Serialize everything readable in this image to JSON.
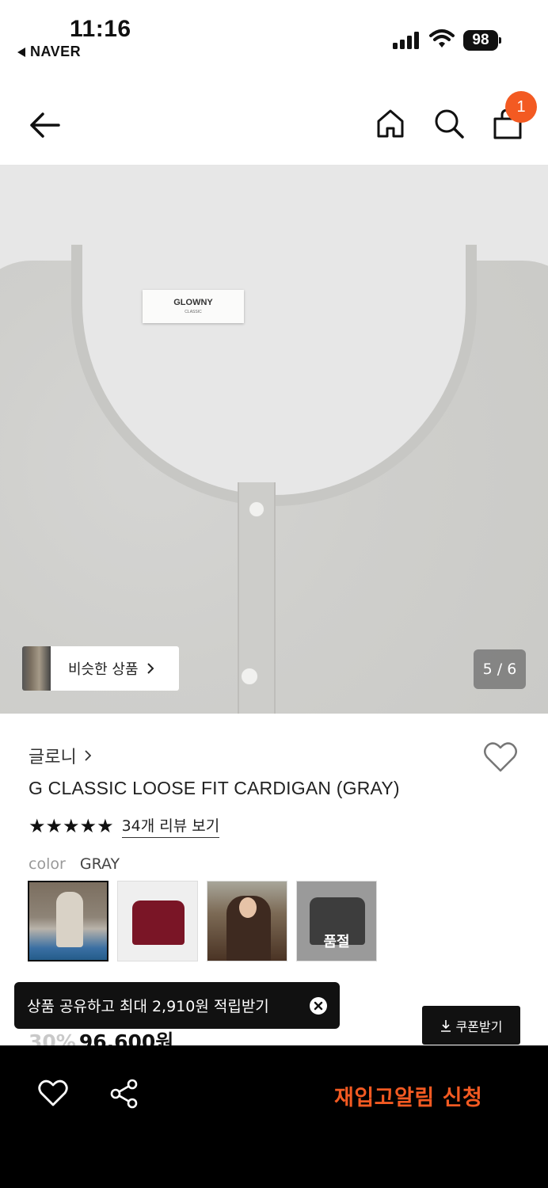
{
  "status_bar": {
    "time": "11:16",
    "back_app": "NAVER",
    "battery": "98"
  },
  "nav": {
    "cart_badge": "1"
  },
  "gallery": {
    "label_brand": "GLOWNY",
    "label_sub": "CLASSIC",
    "similar_label": "비슷한 상품",
    "counter": "5 / 6"
  },
  "product": {
    "brand": "글로니",
    "title": "G CLASSIC LOOSE FIT CARDIGAN (GRAY)",
    "stars": "★★★★★",
    "reviews_link": "34개 리뷰 보기",
    "color_label": "color",
    "color_value": "GRAY",
    "sold_out_label": "품절"
  },
  "promo": {
    "toast": "상품 공유하고 최대 2,910원 적립받기",
    "coupon_button": "쿠폰받기"
  },
  "price": {
    "discount": "30%",
    "amount": "96,600원"
  },
  "bottom_bar": {
    "restock_button": "재입고알림 신청"
  },
  "colors": {
    "accent": "#f35a22",
    "dark": "#111111"
  }
}
